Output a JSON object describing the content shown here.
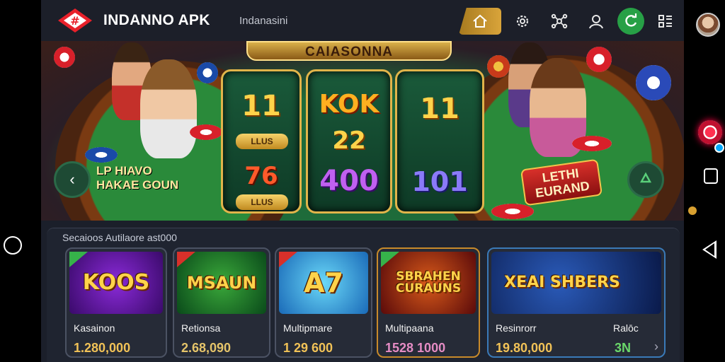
{
  "app": {
    "brand": "INDANNO APK",
    "subtitle": "Indanasini"
  },
  "nav": {
    "items": [
      {
        "icon": "home-icon"
      },
      {
        "icon": "settings-gear-icon"
      },
      {
        "icon": "network-icon"
      },
      {
        "icon": "user-icon"
      },
      {
        "icon": "refresh-icon"
      },
      {
        "icon": "grid-menu-icon"
      }
    ]
  },
  "hero": {
    "banner": "CAIASONNA",
    "reels": [
      {
        "top": "11",
        "tag": "LLUS",
        "middle": "",
        "bottom": "76",
        "bottom_tag": "LLUS"
      },
      {
        "top": "KOK",
        "tag": "",
        "middle": "22",
        "bottom": "400",
        "bottom_tag": ""
      },
      {
        "top": "11",
        "tag": "",
        "middle": "",
        "bottom": "101",
        "bottom_tag": ""
      }
    ],
    "promo_left_line1": "LP HIAVO",
    "promo_left_line2": "HAKAE GOUN",
    "promo_right": "LETHI EURAND"
  },
  "games": {
    "section_title": "Secaioos  Autilaore ast000",
    "cards": [
      {
        "art_title": "KOOS",
        "name": "Kasainon",
        "value": "1.280,000",
        "value_color": "#f1c257"
      },
      {
        "art_title": "MSAUN",
        "name": "Retionsa",
        "value": "2.68,090",
        "value_color": "#e5c46a"
      },
      {
        "art_title": "A7",
        "name": "Multipmare",
        "value": "1 29  600",
        "value_color": "#f1c257"
      },
      {
        "art_title": "SBRAHEN CURAUNS",
        "name": "Multipaana",
        "value": "1528 1000",
        "value_color": "#e58cc4"
      },
      {
        "art_title": "XEAI SHBERS",
        "name": "Resinrorr",
        "value": "19.80,000",
        "value_color": "#f1c257",
        "side_name": "Ralōc",
        "side_value": "3N"
      }
    ]
  },
  "colors": {
    "accent_gold": "#d9a43a",
    "accent_green": "#27a046",
    "panel": "#1f2430"
  }
}
